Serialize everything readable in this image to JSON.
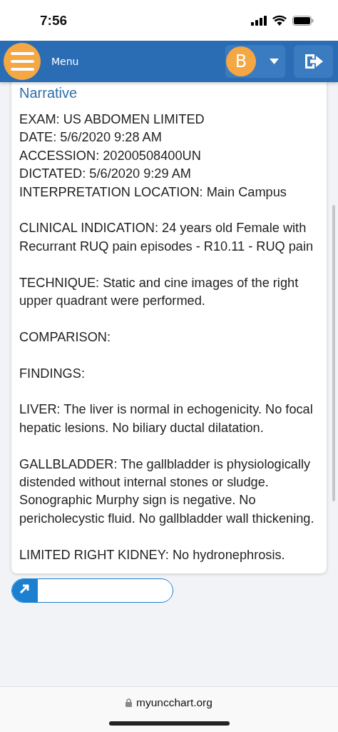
{
  "status_bar": {
    "time": "7:56"
  },
  "header": {
    "menu_label": "Menu",
    "avatar_letter": "B"
  },
  "report": {
    "heading": "Narrative",
    "sections": [
      [
        "EXAM: US ABDOMEN LIMITED",
        "DATE: 5/6/2020 9:28 AM",
        "ACCESSION: 20200508400UN",
        "DICTATED: 5/6/2020 9:29 AM",
        "INTERPRETATION LOCATION: Main Campus"
      ],
      [
        "CLINICAL INDICATION: 24 years old Female with Recurrant RUQ pain episodes - R10.11 - RUQ pain"
      ],
      [
        "TECHNIQUE: Static and cine images of the right upper quadrant were performed."
      ],
      [
        "COMPARISON:"
      ],
      [
        "FINDINGS:"
      ],
      [
        "LIVER: The liver is normal in echogenicity. No focal hepatic lesions. No biliary ductal dilatation."
      ],
      [
        "GALLBLADDER: The gallbladder is physiologically distended without internal stones or sludge. Sonographic Murphy sign is negative. No pericholecystic fluid. No gallbladder wall thickening."
      ],
      [
        "LIMITED RIGHT KIDNEY: No hydronephrosis."
      ]
    ]
  },
  "browser_bar": {
    "url": "myuncchart.org"
  }
}
